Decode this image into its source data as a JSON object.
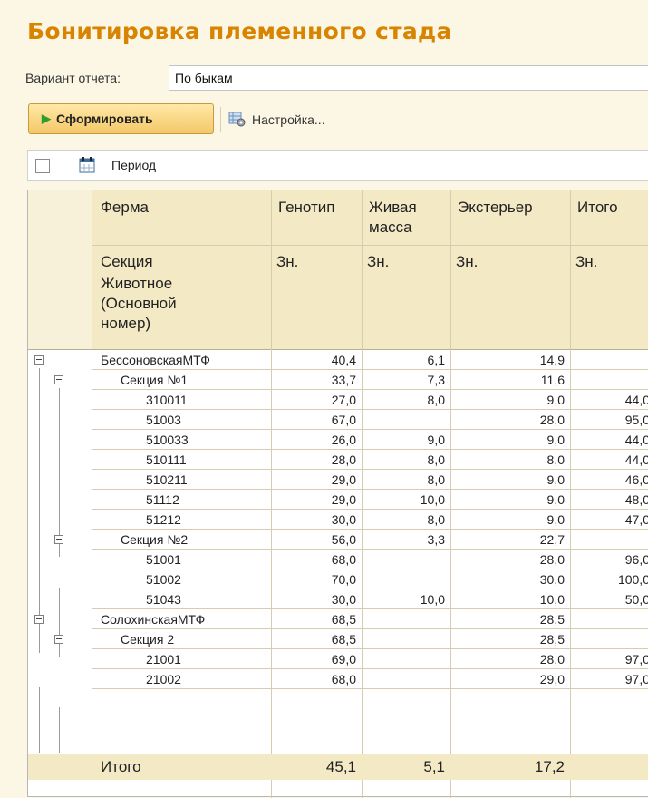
{
  "page": {
    "title": "Бонитировка племенного стада"
  },
  "variant": {
    "label": "Вариант отчета:",
    "value": "По быкам"
  },
  "toolbar": {
    "form_label": "Сформировать",
    "setup_label": "Настройка..."
  },
  "period": {
    "label": "Период"
  },
  "table": {
    "headers": {
      "farm": "Ферма",
      "genotype": "Генотип",
      "weight_1": "Живая",
      "weight_2": "масса",
      "exterior": "Экстерьер",
      "total": "Итого",
      "section": "Секция",
      "animal_1": "Животное",
      "animal_2": "(Основной",
      "animal_3": "номер)",
      "zn_genotype": "Зн.",
      "zn_weight": "Зн.",
      "zn_exterior": "Зн.",
      "zn_total": "Зн."
    },
    "rows": [
      {
        "level": 0,
        "name": "БессоновскаяМТФ",
        "genotype": "40,4",
        "weight": "6,1",
        "exterior": "14,9",
        "total": ""
      },
      {
        "level": 1,
        "name": "Секция №1",
        "genotype": "33,7",
        "weight": "7,3",
        "exterior": "11,6",
        "total": ""
      },
      {
        "level": 2,
        "name": "310011",
        "genotype": "27,0",
        "weight": "8,0",
        "exterior": "9,0",
        "total": "44,0"
      },
      {
        "level": 2,
        "name": "51003",
        "genotype": "67,0",
        "weight": "",
        "exterior": "28,0",
        "total": "95,0"
      },
      {
        "level": 2,
        "name": "510033",
        "genotype": "26,0",
        "weight": "9,0",
        "exterior": "9,0",
        "total": "44,0"
      },
      {
        "level": 2,
        "name": "510111",
        "genotype": "28,0",
        "weight": "8,0",
        "exterior": "8,0",
        "total": "44,0"
      },
      {
        "level": 2,
        "name": "510211",
        "genotype": "29,0",
        "weight": "8,0",
        "exterior": "9,0",
        "total": "46,0"
      },
      {
        "level": 2,
        "name": "51112",
        "genotype": "29,0",
        "weight": "10,0",
        "exterior": "9,0",
        "total": "48,0"
      },
      {
        "level": 2,
        "name": "51212",
        "genotype": "30,0",
        "weight": "8,0",
        "exterior": "9,0",
        "total": "47,0"
      },
      {
        "level": 1,
        "name": "Секция №2",
        "genotype": "56,0",
        "weight": "3,3",
        "exterior": "22,7",
        "total": ""
      },
      {
        "level": 2,
        "name": "51001",
        "genotype": "68,0",
        "weight": "",
        "exterior": "28,0",
        "total": "96,0"
      },
      {
        "level": 2,
        "name": "51002",
        "genotype": "70,0",
        "weight": "",
        "exterior": "30,0",
        "total": "100,0"
      },
      {
        "level": 2,
        "name": "51043",
        "genotype": "30,0",
        "weight": "10,0",
        "exterior": "10,0",
        "total": "50,0"
      },
      {
        "level": 0,
        "name": "СолохинскаяМТФ",
        "genotype": "68,5",
        "weight": "",
        "exterior": "28,5",
        "total": ""
      },
      {
        "level": 1,
        "name": "Секция 2",
        "genotype": "68,5",
        "weight": "",
        "exterior": "28,5",
        "total": ""
      },
      {
        "level": 2,
        "name": "21001",
        "genotype": "69,0",
        "weight": "",
        "exterior": "28,0",
        "total": "97,0"
      },
      {
        "level": 2,
        "name": "21002",
        "genotype": "68,0",
        "weight": "",
        "exterior": "29,0",
        "total": "97,0"
      }
    ],
    "totals": {
      "label": "Итого",
      "genotype": "45,1",
      "weight": "5,1",
      "exterior": "17,2",
      "total": ""
    }
  }
}
